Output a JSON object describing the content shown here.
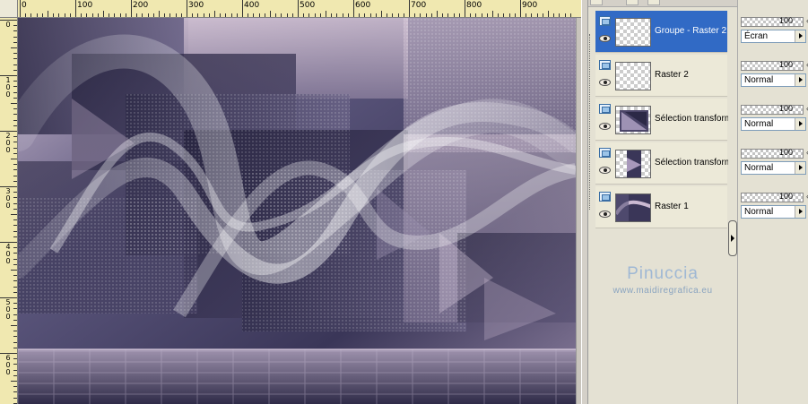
{
  "ruler": {
    "top_labels": [
      "0",
      "100",
      "200",
      "300",
      "400",
      "500",
      "600",
      "700",
      "800",
      "900"
    ],
    "left_labels": [
      "0",
      "1\n0\n0",
      "2\n0\n0",
      "3\n0\n0",
      "4\n0\n0",
      "5\n0\n0",
      "6\n0\n0"
    ]
  },
  "layers": [
    {
      "name": "Groupe - Raster 2",
      "selected": true,
      "opacity": "100",
      "blend": "Écran",
      "thumb": "transparent"
    },
    {
      "name": "Raster 2",
      "selected": false,
      "opacity": "100",
      "blend": "Normal",
      "thumb": "transparent"
    },
    {
      "name": "Sélection transformée",
      "selected": false,
      "opacity": "100",
      "blend": "Normal",
      "thumb": "purple-diagonal"
    },
    {
      "name": "Sélection transformée",
      "selected": false,
      "opacity": "100",
      "blend": "Normal",
      "thumb": "purple-band"
    },
    {
      "name": "Raster 1",
      "selected": false,
      "opacity": "100",
      "blend": "Normal",
      "thumb": "purple-full"
    }
  ],
  "watermark": {
    "title": "Pinuccia",
    "url": "www.maidiregrafica.eu"
  },
  "colors": {
    "selection": "#316ac5",
    "canvas_dark": "#2e2b4a",
    "canvas_light": "#c7b8cf"
  },
  "icons": {
    "visibility": "layer-visibility-icon",
    "eye": "eye-icon"
  }
}
